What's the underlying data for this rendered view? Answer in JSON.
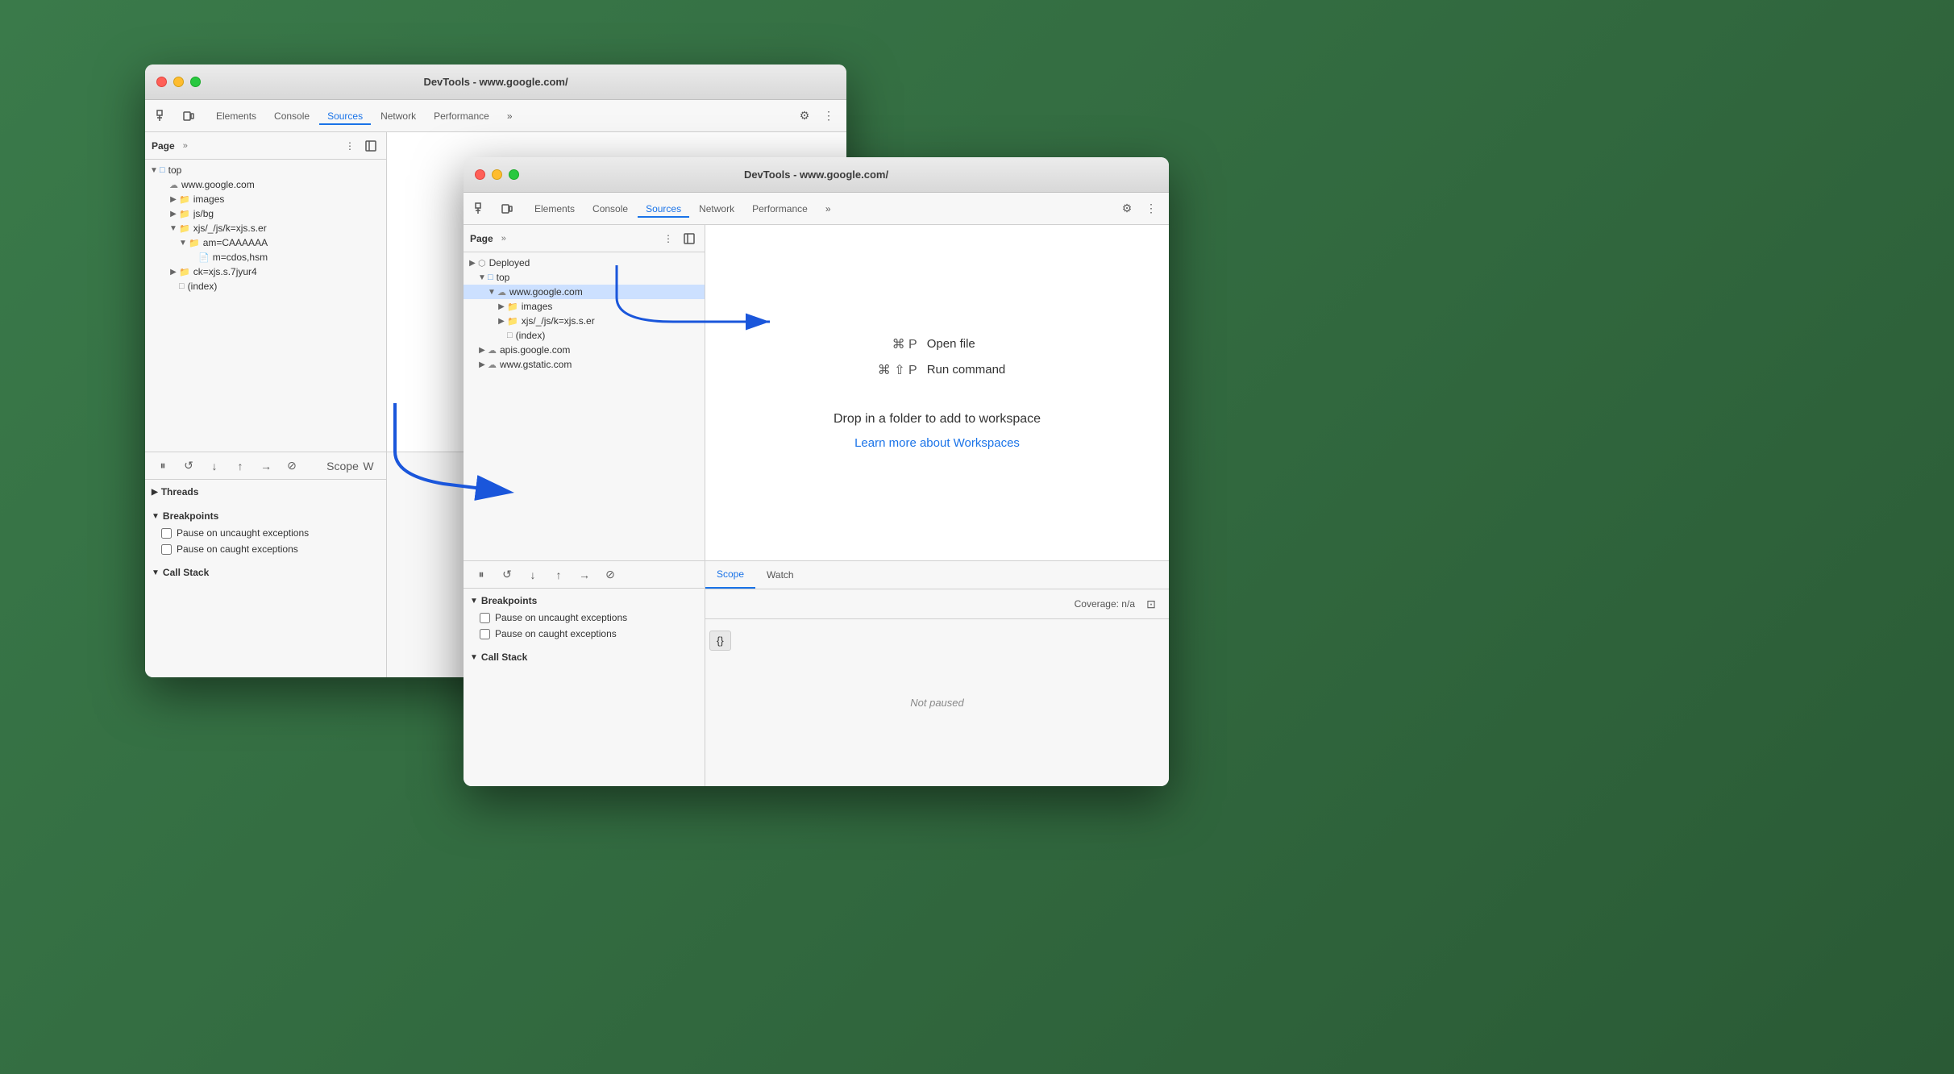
{
  "window_back": {
    "title": "DevTools - www.google.com/",
    "tabs": {
      "icons": [
        "cursor-icon",
        "box-icon"
      ],
      "items": [
        "Elements",
        "Console",
        "Sources",
        "Network",
        "Performance",
        "more-icon"
      ],
      "active": "Sources"
    },
    "sidebar": {
      "header": {
        "page_label": "Page",
        "more_label": "»",
        "more_dots": "⋮"
      },
      "tree": [
        {
          "level": 0,
          "arrow": "▼",
          "icon": "folder",
          "label": "top"
        },
        {
          "level": 1,
          "arrow": " ",
          "icon": "cloud",
          "label": "www.google.com"
        },
        {
          "level": 2,
          "arrow": "▶",
          "icon": "folder",
          "label": "images"
        },
        {
          "level": 2,
          "arrow": "▶",
          "icon": "folder",
          "label": "js/bg"
        },
        {
          "level": 2,
          "arrow": "▼",
          "icon": "folder",
          "label": "xjs/_/js/k=xjs.s.er"
        },
        {
          "level": 3,
          "arrow": "▼",
          "icon": "folder",
          "label": "am=CAAAAAA"
        },
        {
          "level": 4,
          "arrow": " ",
          "icon": "file",
          "label": "m=cdos,hsm"
        },
        {
          "level": 2,
          "arrow": "▶",
          "icon": "folder",
          "label": "ck=xjs.s.7jyur4"
        },
        {
          "level": 2,
          "arrow": " ",
          "icon": "file",
          "label": "(index)"
        }
      ]
    },
    "editor": {
      "shortcut1_key": "⌘ P",
      "shortcut1_desc": "",
      "shortcut2_key": "⌘ ⇧ P",
      "shortcut2_desc": "",
      "drop_text": "Drop in a folder",
      "learn_more": "Learn more a"
    },
    "bottom": {
      "toolbar_icons": [
        "pause-icon",
        "step-over-icon",
        "step-into-icon",
        "step-out-icon",
        "step-forward-icon",
        "deactivate-icon"
      ],
      "scope_label": "Scope",
      "watch_label": "W",
      "sections": [
        {
          "label": "Threads",
          "expanded": false
        },
        {
          "label": "Breakpoints",
          "expanded": true
        },
        {
          "label": "Call Stack",
          "expanded": false
        }
      ],
      "checkboxes": [
        {
          "label": "Pause on uncaught exceptions",
          "checked": false
        },
        {
          "label": "Pause on caught exceptions",
          "checked": false
        }
      ]
    }
  },
  "window_front": {
    "title": "DevTools - www.google.com/",
    "tabs": {
      "items": [
        "Elements",
        "Console",
        "Sources",
        "Network",
        "Performance",
        "more-icon"
      ],
      "active": "Sources"
    },
    "sidebar": {
      "header": {
        "page_label": "Page",
        "more_label": "»",
        "more_dots": "⋮"
      },
      "tree": [
        {
          "level": 0,
          "arrow": "▶",
          "icon": "deployed",
          "label": "Deployed"
        },
        {
          "level": 1,
          "arrow": "▼",
          "icon": "folder",
          "label": "top",
          "selected": false
        },
        {
          "level": 2,
          "arrow": "▼",
          "icon": "cloud",
          "label": "www.google.com",
          "selected": true
        },
        {
          "level": 3,
          "arrow": "▶",
          "icon": "folder",
          "label": "images"
        },
        {
          "level": 3,
          "arrow": "▶",
          "icon": "folder",
          "label": "xjs/_/js/k=xjs.s.er"
        },
        {
          "level": 3,
          "arrow": " ",
          "icon": "file",
          "label": "(index)"
        },
        {
          "level": 1,
          "arrow": "▶",
          "icon": "cloud",
          "label": "apis.google.com"
        },
        {
          "level": 1,
          "arrow": "▶",
          "icon": "cloud",
          "label": "www.gstatic.com"
        }
      ]
    },
    "editor": {
      "shortcut1_key": "⌘ P",
      "shortcut1_desc": "Open file",
      "shortcut2_key": "⌘ ⇧ P",
      "shortcut2_desc": "Run command",
      "drop_text": "Drop in a folder to add to workspace",
      "learn_more": "Learn more about Workspaces"
    },
    "bottom": {
      "sections": [
        {
          "label": "Breakpoints",
          "expanded": true
        },
        {
          "label": "Call Stack",
          "expanded": false
        }
      ],
      "checkboxes": [
        {
          "label": "Pause on uncaught exceptions",
          "checked": false
        },
        {
          "label": "Pause on caught exceptions",
          "checked": false
        }
      ],
      "scope_label": "Scope",
      "watch_label": "Watch",
      "not_paused": "Not paused",
      "coverage_label": "Coverage: n/a"
    },
    "format_btn": "{}"
  }
}
